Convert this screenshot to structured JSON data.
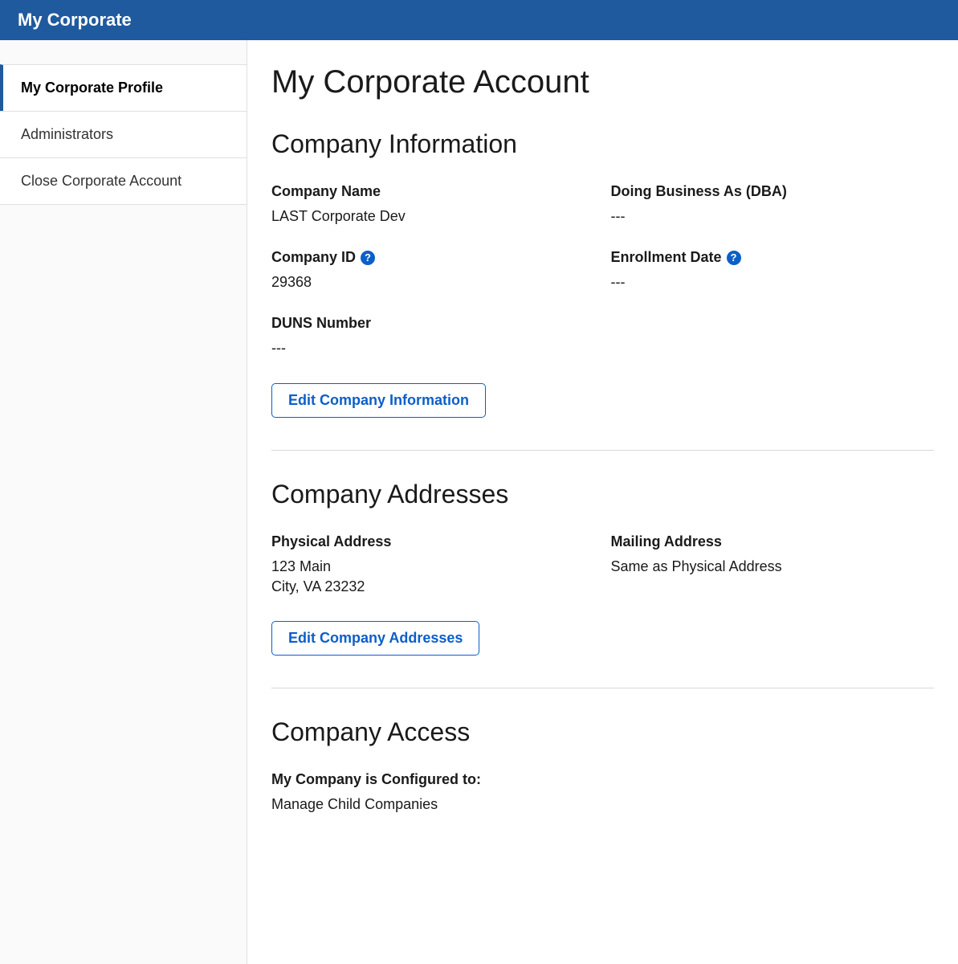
{
  "header": {
    "title": "My Corporate"
  },
  "sidebar": {
    "items": [
      {
        "label": "My Corporate Profile",
        "active": true
      },
      {
        "label": "Administrators",
        "active": false
      },
      {
        "label": "Close Corporate Account",
        "active": false
      }
    ]
  },
  "page": {
    "title": "My Corporate Account"
  },
  "company_info": {
    "section_title": "Company Information",
    "company_name_label": "Company Name",
    "company_name_value": "LAST Corporate Dev",
    "dba_label": "Doing Business As (DBA)",
    "dba_value": "---",
    "company_id_label": "Company ID",
    "company_id_value": "29368",
    "enrollment_date_label": "Enrollment Date",
    "enrollment_date_value": "---",
    "duns_label": "DUNS Number",
    "duns_value": "---",
    "edit_button": "Edit Company Information",
    "help_glyph": "?"
  },
  "company_addresses": {
    "section_title": "Company Addresses",
    "physical_label": "Physical Address",
    "physical_line1": "123 Main",
    "physical_line2": "City, VA 23232",
    "mailing_label": "Mailing Address",
    "mailing_value": "Same as Physical Address",
    "edit_button": "Edit Company Addresses"
  },
  "company_access": {
    "section_title": "Company Access",
    "configured_label": "My Company is Configured to:",
    "configured_value": "Manage Child Companies"
  }
}
